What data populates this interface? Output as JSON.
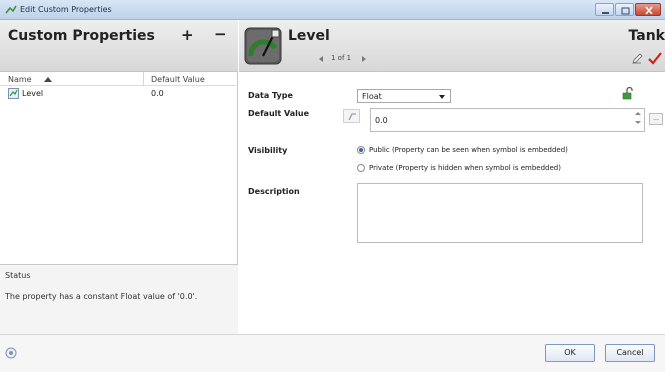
{
  "window": {
    "title": "Edit Custom Properties",
    "controls": [
      "minimize-icon",
      "restore-icon",
      "close-icon"
    ]
  },
  "left_panel": {
    "title": "Custom Properties",
    "add_label": "+",
    "remove_label": "−",
    "columns": {
      "name": "Name",
      "default_value": "Default Value"
    },
    "rows": [
      {
        "name": "Level",
        "default_value": "0.0",
        "icon": "property-icon"
      }
    ],
    "status": {
      "label": "Status",
      "text": "The property has a constant Float value of '0.0'."
    }
  },
  "right_panel": {
    "symbol_name": "Level",
    "pager": "1 of 1",
    "object_name": "Tank",
    "fields": {
      "data_type_label": "Data Type",
      "data_type_value": "Float",
      "default_value_label": "Default Value",
      "default_value": "0.0",
      "more_label": "...",
      "visibility_label": "Visibility",
      "visibility_options": [
        {
          "label": "Public (Property can be seen when symbol is embedded)",
          "selected": true
        },
        {
          "label": "Private (Property is hidden when symbol is embedded)",
          "selected": false
        }
      ],
      "description_label": "Description",
      "description_value": ""
    }
  },
  "buttons": {
    "ok": "OK",
    "cancel": "Cancel"
  },
  "colors": {
    "accent": "#3c63a6",
    "check": "#cc2222",
    "symbol_green": "#3f9b3f"
  }
}
